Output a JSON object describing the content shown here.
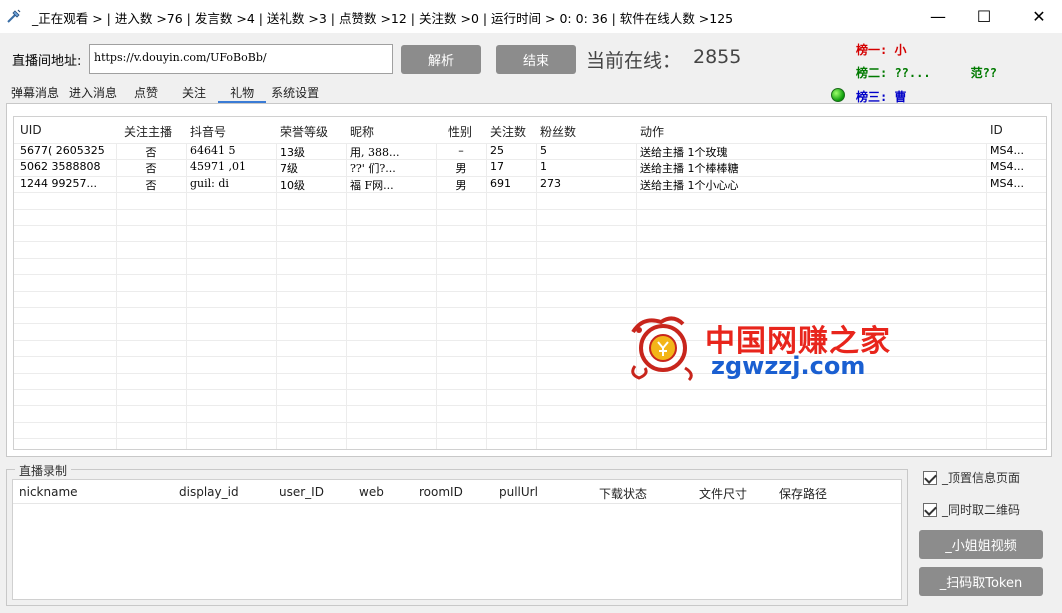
{
  "window": {
    "title": "_正在观看 > | 进入数 >76 | 发言数 >4 | 送礼数 >3 | 点赞数 >12 | 关注数 >0 | 运行时间 >   0:  0:  36 | 软件在线人数 >125",
    "minimize": "—",
    "maximize": "☐",
    "close": "✕"
  },
  "form": {
    "url_label": "直播间地址:",
    "url_value": "https://v.douyin.com/UFoBoBb/",
    "parse_button": "解析",
    "end_button": "结束",
    "online_label": "当前在线：",
    "online_count": "2855"
  },
  "ranks": {
    "rank1": "榜一: 小",
    "rank2": "榜二: ??...",
    "rank2_tail": "范??",
    "rank3": "榜三: 曹"
  },
  "tabs": [
    {
      "label": "弹幕消息"
    },
    {
      "label": "进入消息"
    },
    {
      "label": "点赞"
    },
    {
      "label": "关注"
    },
    {
      "label": "礼物"
    },
    {
      "label": "系统设置"
    }
  ],
  "gift_table": {
    "columns": [
      "UID",
      "关注主播",
      "抖音号",
      "荣誉等级",
      "昵称",
      "性别",
      "关注数",
      "粉丝数",
      "动作",
      "ID"
    ],
    "rows": [
      [
        "5677(  2605325",
        "否",
        "64641      5",
        "13级",
        "用,      388...",
        "–",
        "25",
        "5",
        "送给主播 1个玫瑰",
        "MS4..."
      ],
      [
        "5062   3588808",
        "否",
        "45971   ,01",
        "7级",
        "??'     们?...",
        "男",
        "17",
        "1",
        "送给主播 1个棒棒糖",
        "MS4..."
      ],
      [
        "1244  99257...",
        "否",
        "guil:      di",
        "10级",
        "福     F网...",
        "男",
        "691",
        "273",
        "送给主播 1个小心心",
        "MS4..."
      ]
    ]
  },
  "watermark": {
    "cn": "中国网赚之家",
    "en": "zgwzzj.com"
  },
  "live_record": {
    "group_title": "直播录制",
    "columns": [
      "nickname",
      "display_id",
      "user_ID",
      "web",
      "roomID",
      "pullUrl",
      "下载状态",
      "文件尺寸",
      "保存路径"
    ]
  },
  "side": {
    "checkbox_top_info": "_顶置信息页面",
    "checkbox_qr": "_同时取二维码",
    "btn_video": "_小姐姐视频",
    "btn_token": "_扫码取Token"
  }
}
